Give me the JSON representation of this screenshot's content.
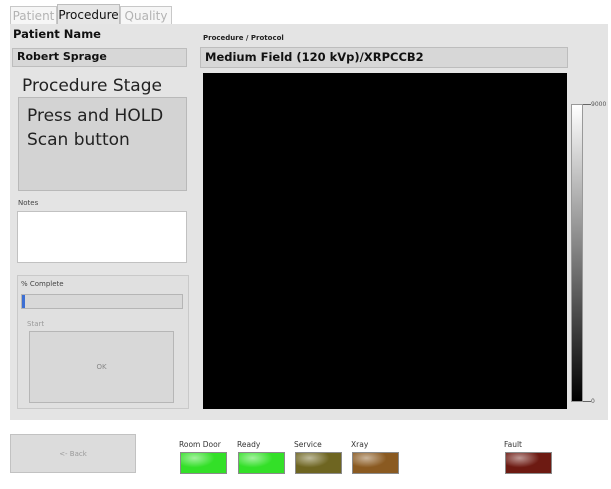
{
  "tabs": [
    {
      "label": "Patient",
      "active": false
    },
    {
      "label": "Procedure",
      "active": true
    },
    {
      "label": "Quality",
      "active": false
    }
  ],
  "patient": {
    "label": "Patient Name",
    "value": "Robert Sprage"
  },
  "procedure": {
    "label": "Procedure / Protocol",
    "value": "Medium Field (120 kVp)/XRPCCB2"
  },
  "stage": {
    "title": "Procedure Stage",
    "message": "Press and HOLD Scan button"
  },
  "notes": {
    "label": "Notes",
    "value": ""
  },
  "progress": {
    "label": "% Complete",
    "percent": 2,
    "fill_color": "#3d6fd3"
  },
  "start": {
    "label": "Start",
    "ok_label": "OK"
  },
  "colorbar": {
    "max_label": "9000",
    "min_label": "0"
  },
  "footer": {
    "back_label": "<- Back",
    "indicators": [
      {
        "label": "Room Door",
        "color": "#33e028"
      },
      {
        "label": "Ready",
        "color": "#33e028"
      },
      {
        "label": "Service",
        "color": "#6e6521"
      },
      {
        "label": "Xray",
        "color": "#8a5a21"
      },
      {
        "label": "Fault",
        "color": "#6d1a12"
      }
    ]
  }
}
